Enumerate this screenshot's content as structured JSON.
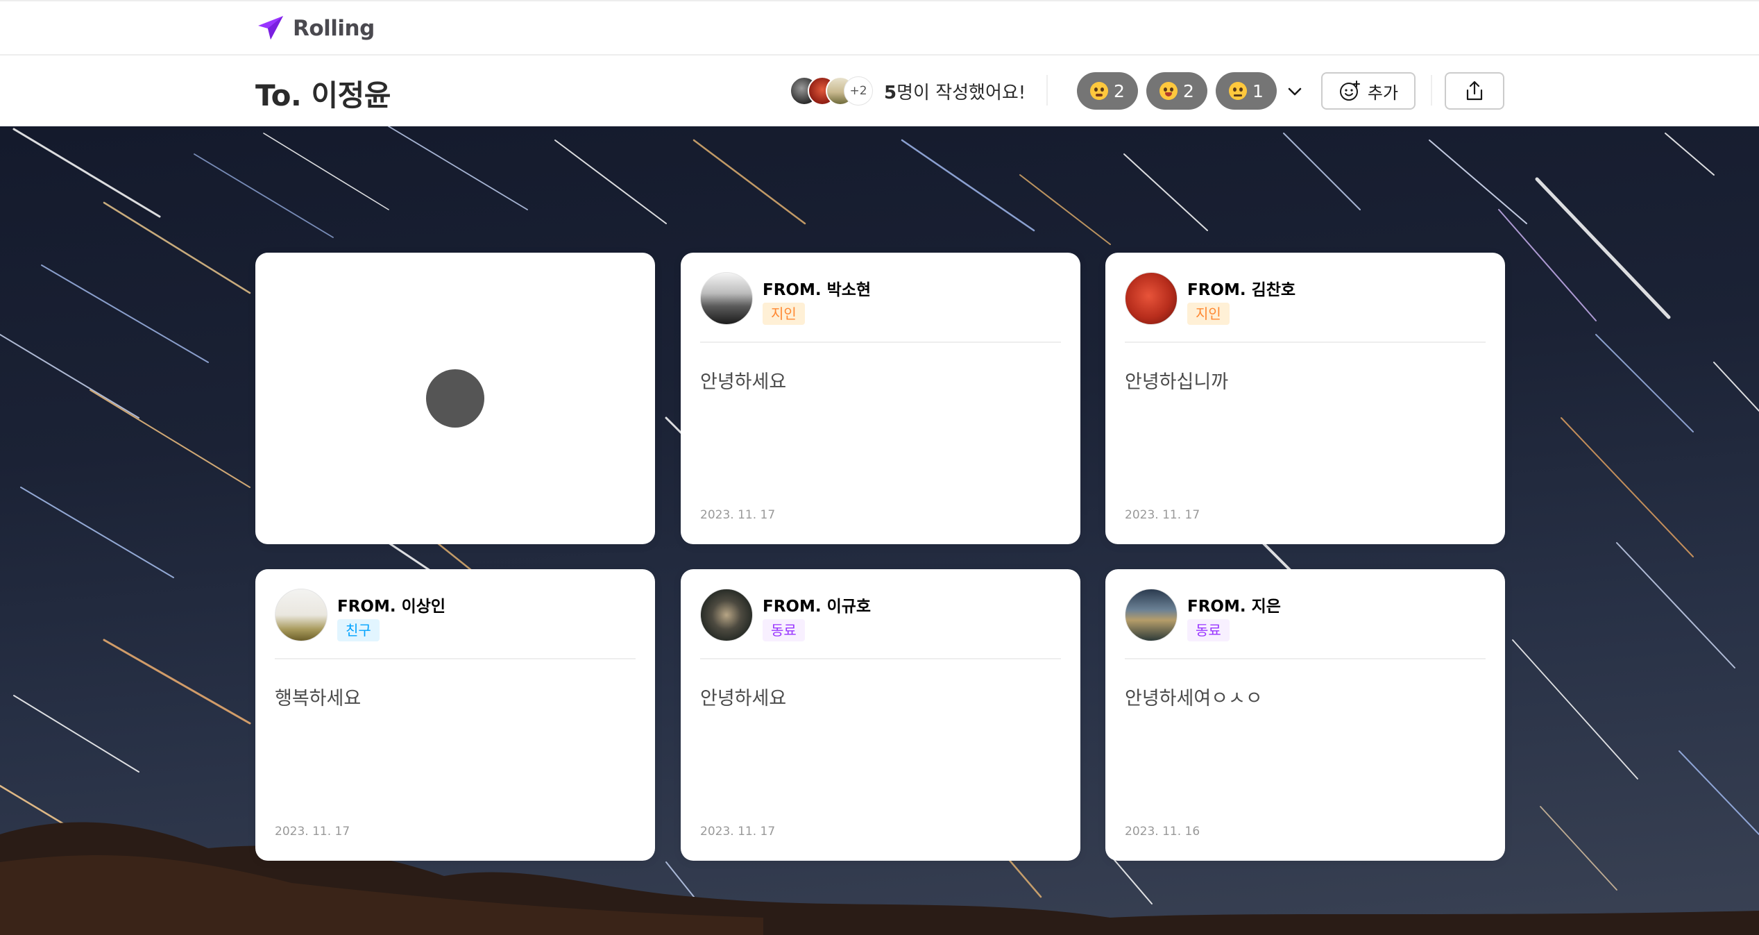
{
  "app": {
    "logo_text": "Rolling",
    "accent_color": "#9935ff"
  },
  "header": {
    "to_title": "To. 이정윤",
    "writers": {
      "more_count": "+2",
      "count_bold": "5",
      "count_text": "명이 작성했어요!"
    },
    "reactions": [
      {
        "emoji": "emoji-face-icon",
        "count": "2"
      },
      {
        "emoji": "emoji-face-icon",
        "count": "2"
      },
      {
        "emoji": "emoji-face-icon",
        "count": "1"
      }
    ],
    "add_reaction_label": "추가"
  },
  "cards": [
    {
      "from": "FROM. 박소현",
      "relationship": "지인",
      "message": "안녕하세요",
      "date": "2023. 11. 17"
    },
    {
      "from": "FROM. 김찬호",
      "relationship": "지인",
      "message": "안녕하십니까",
      "date": "2023. 11. 17"
    },
    {
      "from": "FROM. 이상인",
      "relationship": "친구",
      "message": "행복하세요",
      "date": "2023. 11. 17"
    },
    {
      "from": "FROM. 이규호",
      "relationship": "동료",
      "message": "안녕하세요",
      "date": "2023. 11. 17"
    },
    {
      "from": "FROM. 지은",
      "relationship": "동료",
      "message": "안녕하세여ㅇㅅㅇ",
      "date": "2023. 11. 16"
    }
  ]
}
